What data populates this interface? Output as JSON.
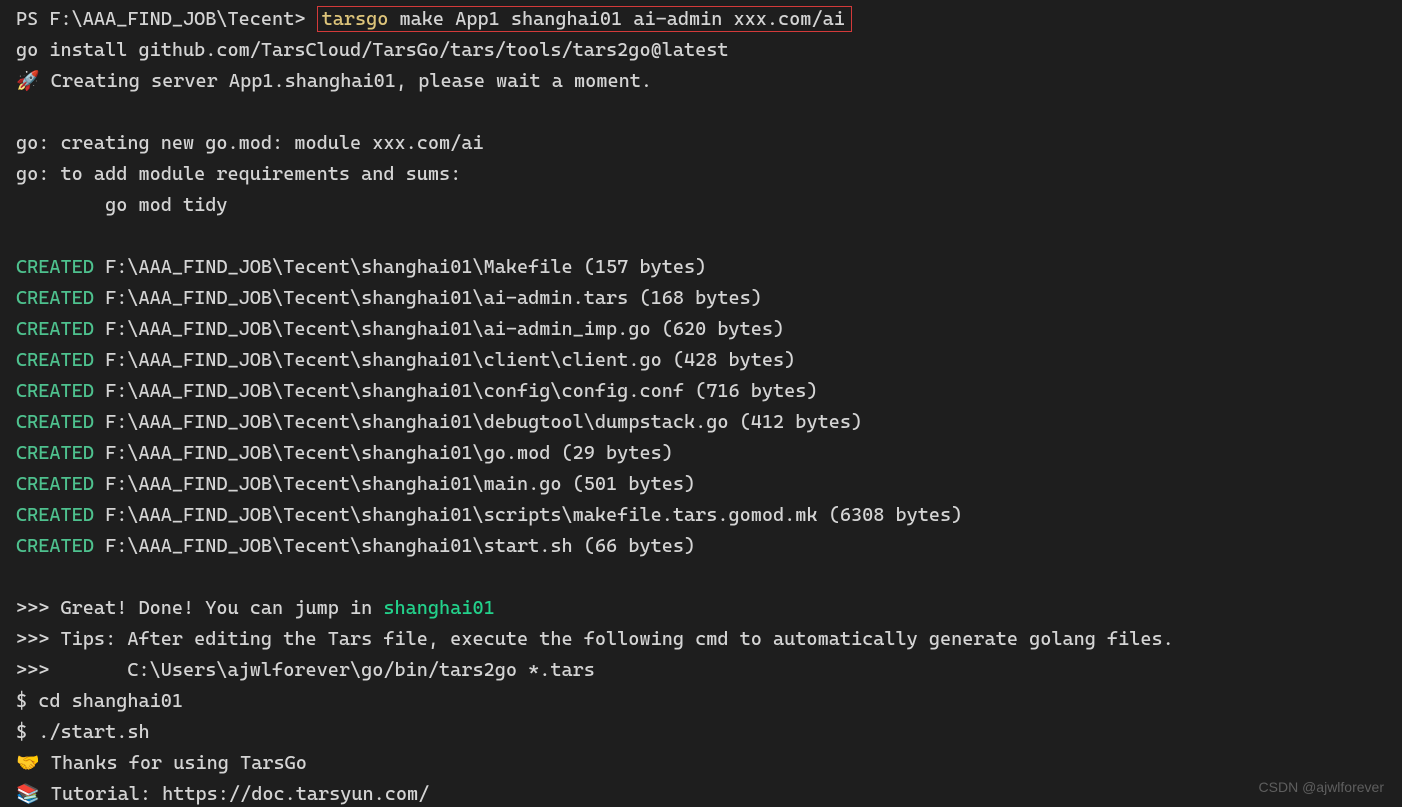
{
  "prompt_prefix": "PS F:\\AAA_FIND_JOB\\Tecent> ",
  "command_first_word": "tarsgo",
  "command_rest": " make App1 shanghai01 ai-admin xxx.com/ai",
  "install_line": "go install github.com/TarsCloud/TarsGo/tars/tools/tars2go@latest",
  "creating_server_emoji": "🚀",
  "creating_server_text": " Creating server App1.shanghai01, please wait a moment.",
  "gomod_line1": "go: creating new go.mod: module xxx.com/ai",
  "gomod_line2": "go: to add module requirements and sums:",
  "gomod_line3": "        go mod tidy",
  "created_label": "CREATED",
  "created": [
    " F:\\AAA_FIND_JOB\\Tecent\\shanghai01\\Makefile (157 bytes)",
    " F:\\AAA_FIND_JOB\\Tecent\\shanghai01\\ai-admin.tars (168 bytes)",
    " F:\\AAA_FIND_JOB\\Tecent\\shanghai01\\ai-admin_imp.go (620 bytes)",
    " F:\\AAA_FIND_JOB\\Tecent\\shanghai01\\client\\client.go (428 bytes)",
    " F:\\AAA_FIND_JOB\\Tecent\\shanghai01\\config\\config.conf (716 bytes)",
    " F:\\AAA_FIND_JOB\\Tecent\\shanghai01\\debugtool\\dumpstack.go (412 bytes)",
    " F:\\AAA_FIND_JOB\\Tecent\\shanghai01\\go.mod (29 bytes)",
    " F:\\AAA_FIND_JOB\\Tecent\\shanghai01\\main.go (501 bytes)",
    " F:\\AAA_FIND_JOB\\Tecent\\shanghai01\\scripts\\makefile.tars.gomod.mk (6308 bytes)",
    " F:\\AAA_FIND_JOB\\Tecent\\shanghai01\\start.sh (66 bytes)"
  ],
  "done_prefix": ">>> Great! Done! You can jump in ",
  "done_project": "shanghai01",
  "tips_line": ">>> Tips: After editing the Tars file, execute the following cmd to automatically generate golang files.",
  "tips_cmd": ">>>       C:\\Users\\ajwlforever\\go/bin/tars2go *.tars",
  "sh_cd": "$ cd shanghai01",
  "sh_start": "$ ./start.sh",
  "thanks_emoji": "🤝",
  "thanks_text": " Thanks for using TarsGo",
  "tutorial_emoji": "📚",
  "tutorial_text": " Tutorial: https://doc.tarsyun.com/",
  "watermark": "CSDN @ajwlforever"
}
